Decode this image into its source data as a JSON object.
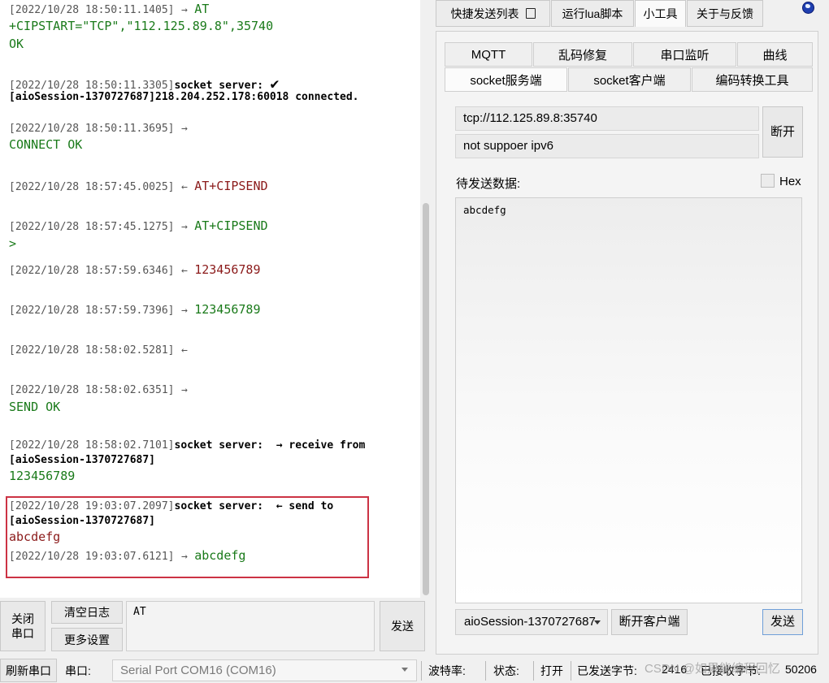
{
  "log": {
    "lines": [
      {
        "ts": "[2022/10/28 18:50:11.1405]",
        "dir": "→",
        "text": "AT"
      },
      {
        "text": "+CIPSTART=\"TCP\",\"112.125.89.8\",35740"
      },
      {
        "text": "OK"
      },
      {
        "ts": "[2022/10/28 18:50:11.3305]",
        "text": "socket server:"
      },
      {
        "text": "[aioSession-1370727687]218.204.252.178:60018 connected."
      },
      {
        "ts": "[2022/10/28 18:50:11.3695]",
        "dir": "→"
      },
      {
        "text": "CONNECT OK"
      },
      {
        "ts": "[2022/10/28 18:57:45.0025]",
        "dir": "←",
        "text": "AT+CIPSEND"
      },
      {
        "ts": "[2022/10/28 18:57:45.1275]",
        "dir": "→",
        "text": "AT+CIPSEND"
      },
      {
        "text": ">"
      },
      {
        "ts": "[2022/10/28 18:57:59.6346]",
        "dir": "←",
        "text": "123456789"
      },
      {
        "ts": "[2022/10/28 18:57:59.7396]",
        "dir": "→",
        "text": "123456789"
      },
      {
        "ts": "[2022/10/28 18:58:02.5281]",
        "dir": "←"
      },
      {
        "ts": "[2022/10/28 18:58:02.6351]",
        "dir": "→"
      },
      {
        "text": "SEND OK"
      },
      {
        "ts": "[2022/10/28 18:58:02.7101]",
        "text": "socket server:  → receive from"
      },
      {
        "text": "[aioSession-1370727687]"
      },
      {
        "text": "123456789"
      },
      {
        "ts": "[2022/10/28 19:03:07.2097]",
        "text": "socket server:  ← send to"
      },
      {
        "text": "[aioSession-1370727687]"
      },
      {
        "text": "abcdefg"
      },
      {
        "ts": "[2022/10/28 19:03:07.6121]",
        "dir": "→",
        "text": "abcdefg"
      }
    ]
  },
  "controls": {
    "close_port": "关闭\n串口",
    "clear_log": "清空日志",
    "more_settings": "更多设置",
    "send_input_value": "AT",
    "send": "发送"
  },
  "statusbar": {
    "refresh_port": "刷新串口",
    "port_label": "串口:",
    "port_value": "Serial Port COM16 (COM16)",
    "baud_label": "波特率:",
    "state_label": "状态:",
    "state_value": "打开",
    "sent_label": "已发送字节:",
    "sent_value": "2416",
    "recv_label": "已接收字节:",
    "recv_value": "50206"
  },
  "right": {
    "top_tabs": [
      "快捷发送列表",
      "运行lua脚本",
      "小工具",
      "关于与反馈"
    ],
    "sub_tabs_row1": [
      "MQTT",
      "乱码修复",
      "串口监听",
      "曲线"
    ],
    "sub_tabs_row2": [
      "socket服务端",
      "socket客户端",
      "编码转换工具"
    ],
    "address": "tcp://112.125.89.8:35740",
    "ipv6": "not suppoer ipv6",
    "disconnect": "断开",
    "pending_label": "待发送数据:",
    "hex_label": "Hex",
    "data_value": "abcdefg",
    "client_select": "aioSession-1370727687",
    "disconnect_client": "断开客户端",
    "send": "发送"
  },
  "watermark": "CSDN @如果能编程回忆"
}
